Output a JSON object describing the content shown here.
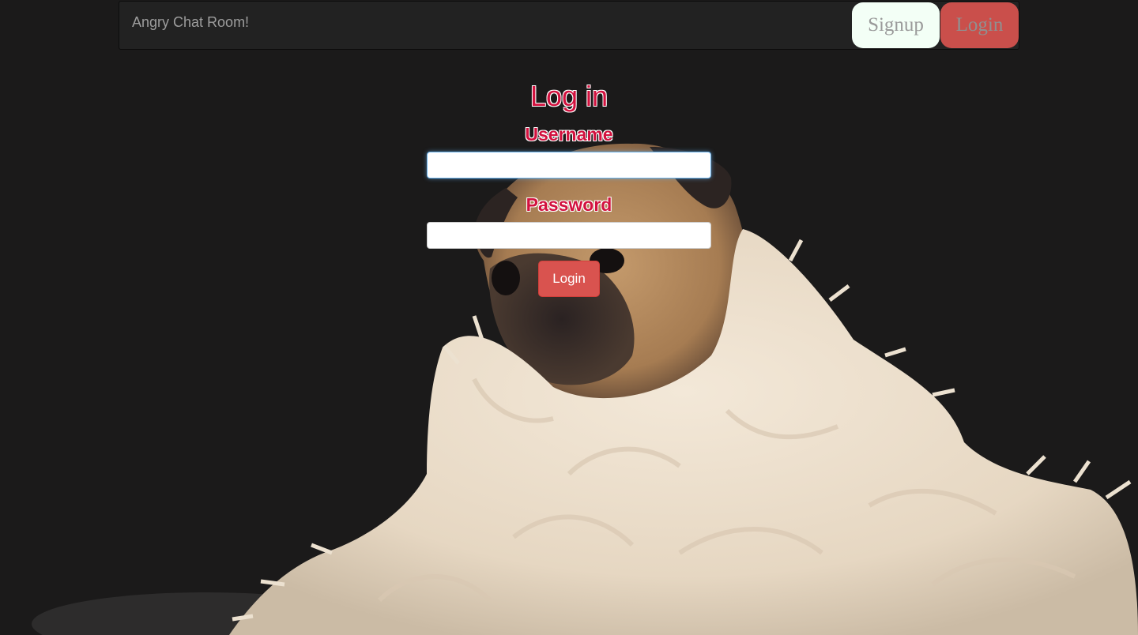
{
  "navbar": {
    "brand": "Angry Chat Room!",
    "signup_label": "Signup",
    "login_label": "Login"
  },
  "login_form": {
    "title": "Log in",
    "username_label": "Username",
    "username_value": "",
    "password_label": "Password",
    "password_value": "",
    "submit_label": "Login"
  },
  "background": {
    "image": "pug wrapped in fluffy white blanket on dark background"
  },
  "colors": {
    "heading_red": "#d2123f",
    "button_red": "#d9534f",
    "navbar_bg": "#222222",
    "signup_bg": "#f3fff6",
    "page_bg": "#1b1a1a"
  }
}
